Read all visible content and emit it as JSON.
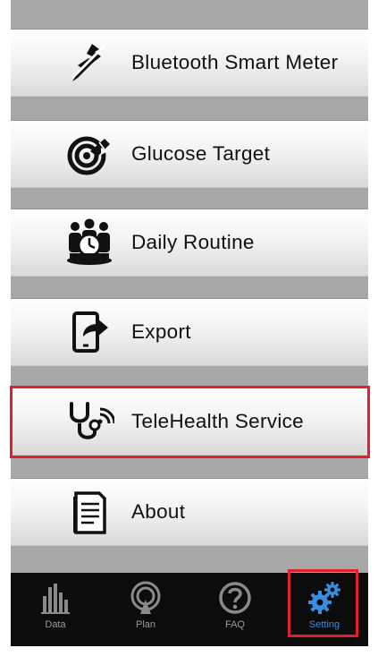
{
  "menu": {
    "items": [
      {
        "label": "Bluetooth Smart Meter",
        "icon": "bluetooth-connect-icon"
      },
      {
        "label": "Glucose Target",
        "icon": "target-icon"
      },
      {
        "label": "Daily Routine",
        "icon": "daily-routine-icon"
      },
      {
        "label": "Export",
        "icon": "export-icon"
      },
      {
        "label": "TeleHealth Service",
        "icon": "stethoscope-icon",
        "highlighted": true
      },
      {
        "label": "About",
        "icon": "document-icon"
      }
    ]
  },
  "tabbar": {
    "tabs": [
      {
        "label": "Data",
        "icon": "bar-chart-icon"
      },
      {
        "label": "Plan",
        "icon": "plan-icon"
      },
      {
        "label": "FAQ",
        "icon": "question-icon"
      },
      {
        "label": "Setting",
        "icon": "gears-icon",
        "active": true
      }
    ]
  },
  "colors": {
    "highlight": "#e0202c",
    "active_tab": "#3a8de0",
    "tabbar_bg": "#0c0c0c"
  }
}
